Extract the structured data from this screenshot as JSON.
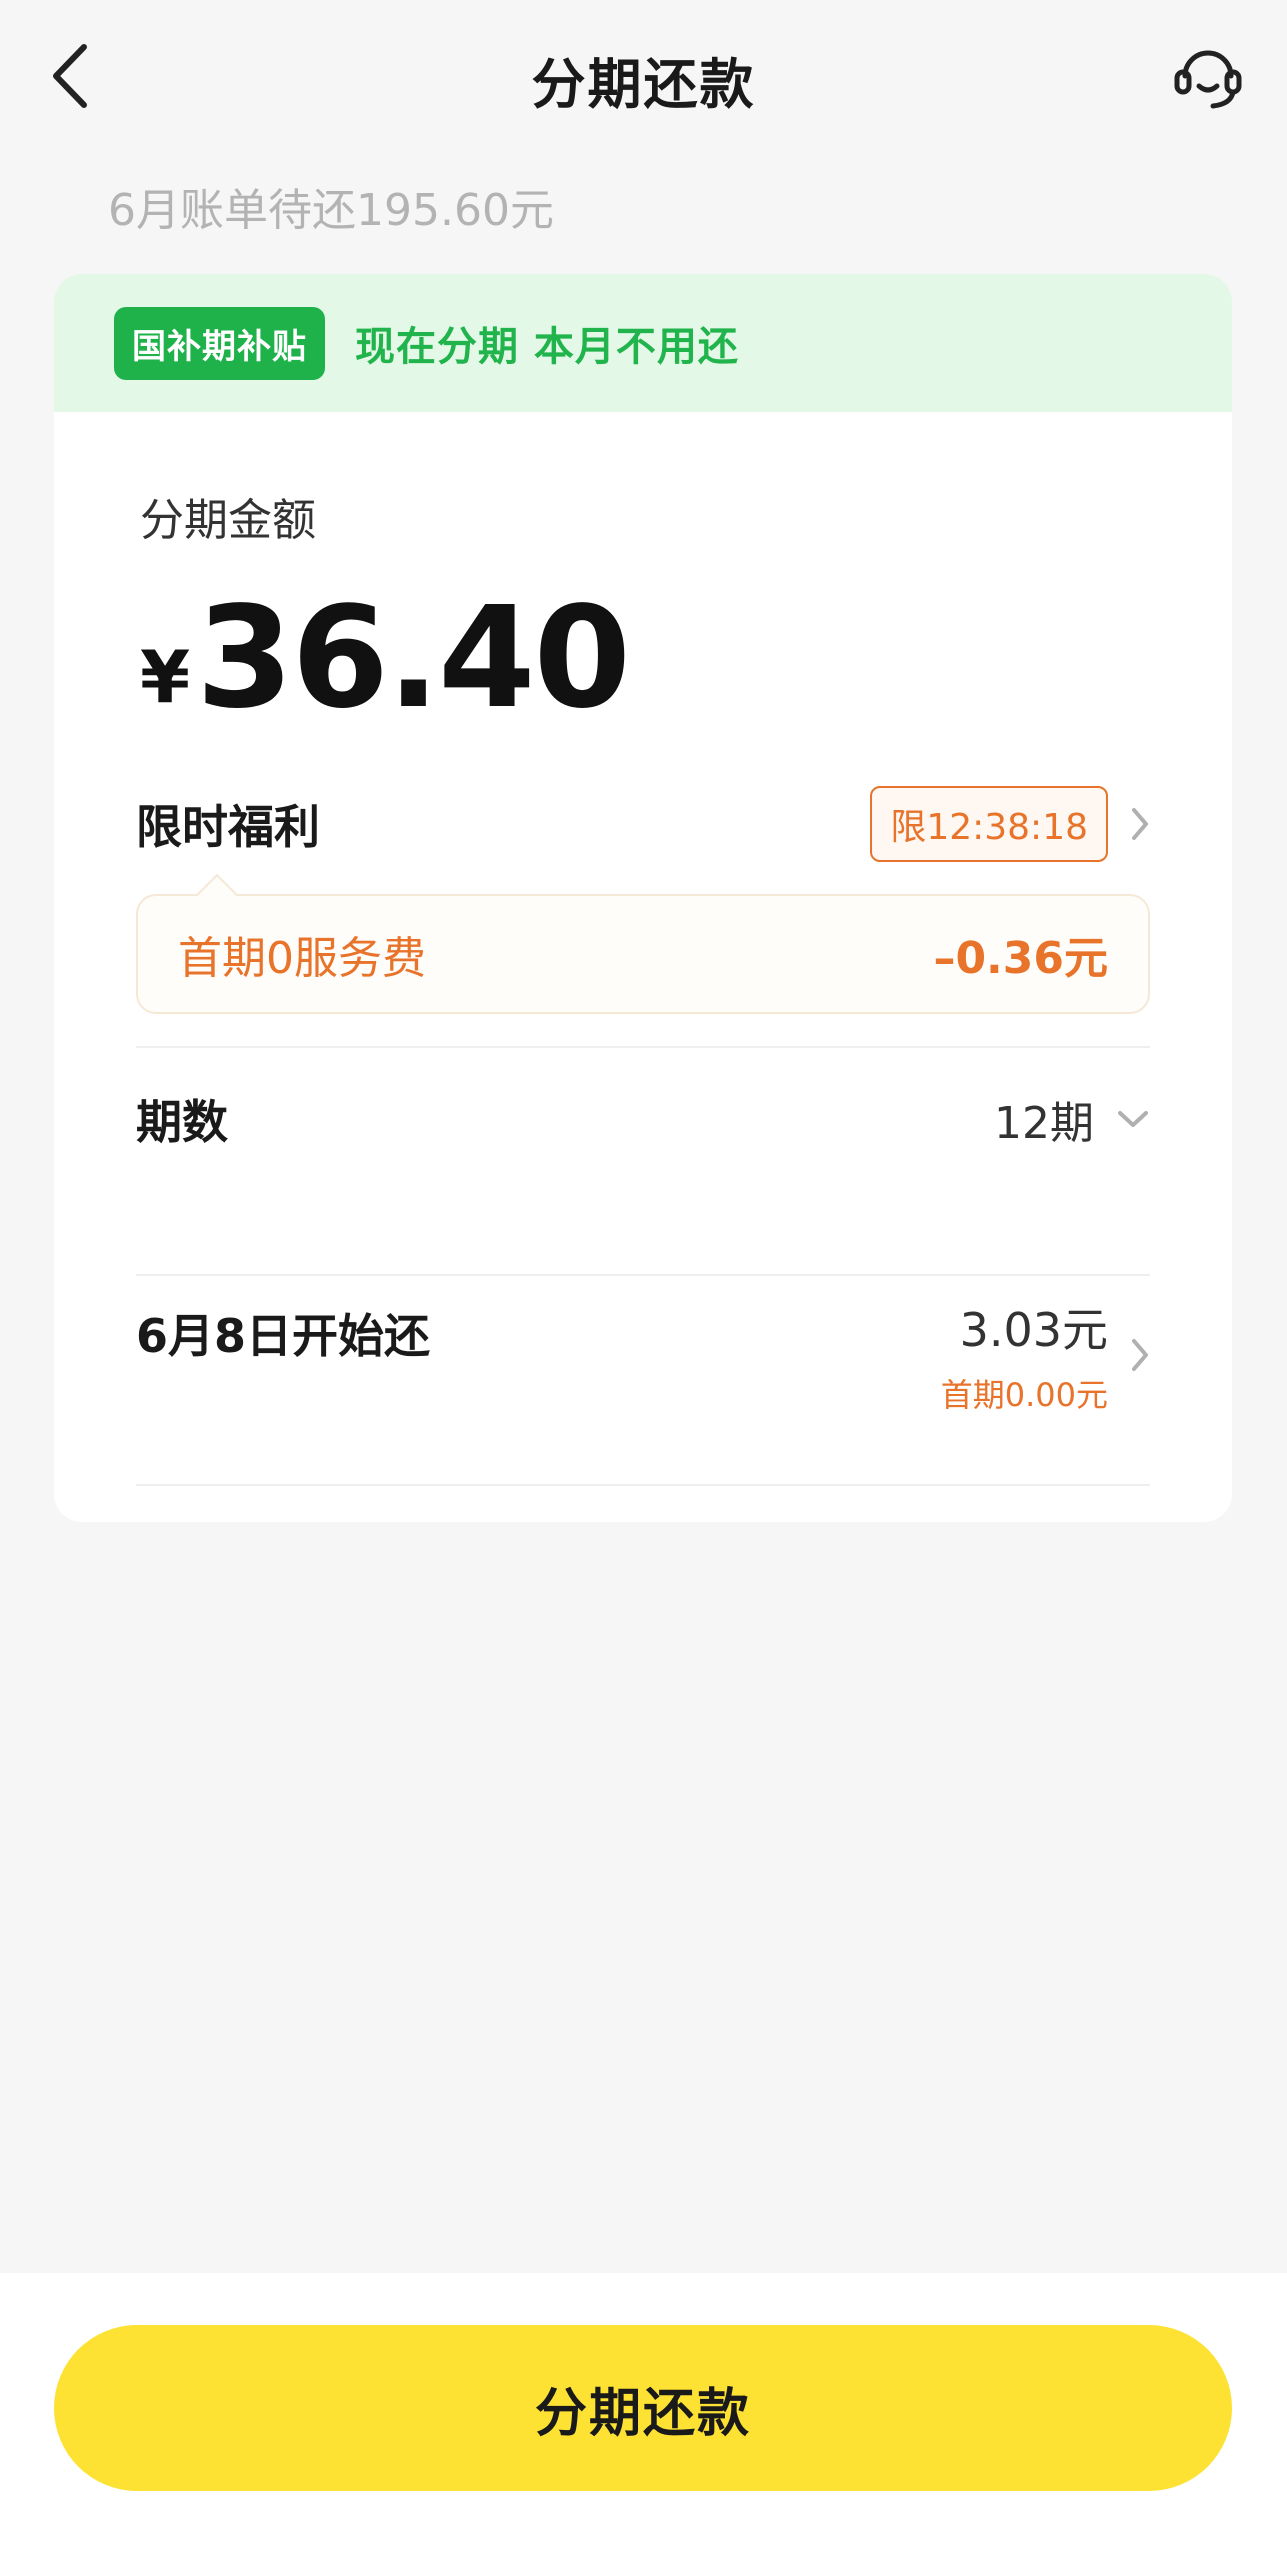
{
  "header": {
    "title": "分期还款",
    "back_icon": "chevron-left-icon",
    "service_icon": "headset-icon"
  },
  "bill": {
    "summary": "6月账单待还195.60元"
  },
  "promo": {
    "badge": "国补期补贴",
    "text": "现在分期 本月不用还",
    "color": "#1fb24a",
    "background": "#e3f8e6"
  },
  "amount": {
    "label": "分期金额",
    "currency": "¥",
    "value": "36.40"
  },
  "benefit": {
    "title": "限时福利",
    "timer": "限12:38:18",
    "item_name": "首期0服务费",
    "item_value": "–0.36元",
    "accent": "#e8732a"
  },
  "period": {
    "label": "期数",
    "value": "12期"
  },
  "start": {
    "label": "6月8日开始还",
    "amount": "3.03元",
    "first": "首期0.00元"
  },
  "submit": {
    "label": "分期还款",
    "color": "#fde233"
  }
}
